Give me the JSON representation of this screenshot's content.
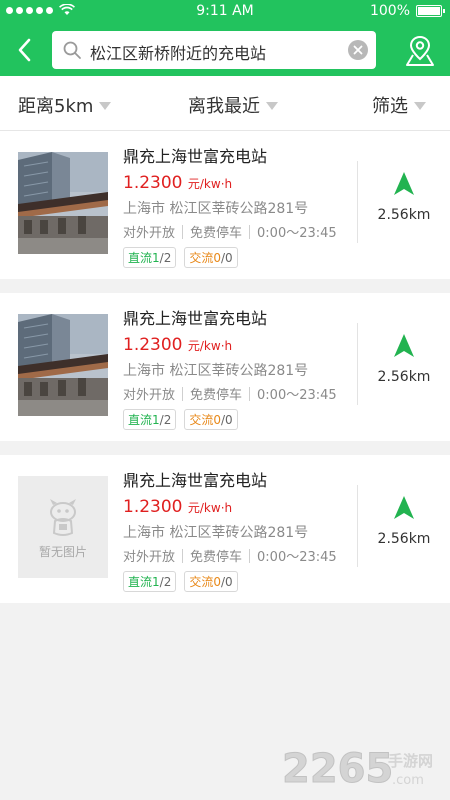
{
  "status_bar": {
    "time": "9:11 AM",
    "battery": "100%"
  },
  "header": {
    "search_text": "松江区新桥附近的充电站"
  },
  "filters": [
    {
      "label": "距离5km"
    },
    {
      "label": "离我最近"
    },
    {
      "label": "筛选"
    }
  ],
  "stations": [
    {
      "name": "鼎充上海世富充电站",
      "price": "1.2300",
      "price_unit": "元/kw·h",
      "address": "上海市 松江区莘砖公路281号",
      "access": "对外开放",
      "parking": "免费停车",
      "hours": "0:00～23:45",
      "dc_label": "直流",
      "dc_free": "1",
      "dc_total": "/2",
      "ac_label": "交流",
      "ac_free": "0",
      "ac_total": "/0",
      "distance": "2.56km",
      "has_image": true
    },
    {
      "name": "鼎充上海世富充电站",
      "price": "1.2300",
      "price_unit": "元/kw·h",
      "address": "上海市 松江区莘砖公路281号",
      "access": "对外开放",
      "parking": "免费停车",
      "hours": "0:00～23:45",
      "dc_label": "直流",
      "dc_free": "1",
      "dc_total": "/2",
      "ac_label": "交流",
      "ac_free": "0",
      "ac_total": "/0",
      "distance": "2.56km",
      "has_image": true
    },
    {
      "name": "鼎充上海世富充电站",
      "price": "1.2300",
      "price_unit": "元/kw·h",
      "address": "上海市 松江区莘砖公路281号",
      "access": "对外开放",
      "parking": "免费停车",
      "hours": "0:00～23:45",
      "dc_label": "直流",
      "dc_free": "1",
      "dc_total": "/2",
      "ac_label": "交流",
      "ac_free": "0",
      "ac_total": "/0",
      "distance": "2.56km",
      "has_image": false,
      "no_image_text": "暂无图片"
    }
  ],
  "watermark": {
    "number": "2265",
    "suffix": "手游网",
    "domain": ".com"
  },
  "colors": {
    "brand": "#22c35e",
    "price": "#e02020",
    "dc": "#22b350",
    "ac": "#e8891a"
  },
  "icons": {
    "back": "chevron-left-icon",
    "search": "search-icon",
    "clear": "clear-icon",
    "map": "map-pin-icon",
    "navigate": "navigate-arrow-icon"
  }
}
